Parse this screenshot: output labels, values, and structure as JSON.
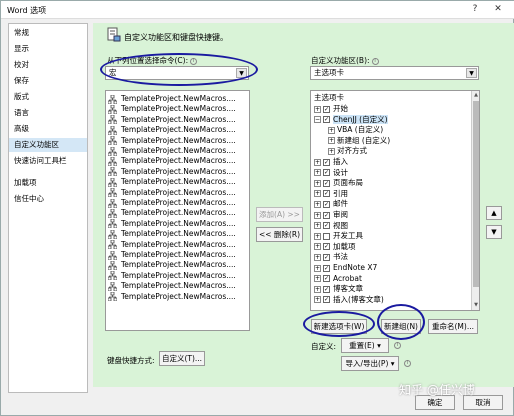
{
  "window": {
    "title": "Word 选项",
    "help_glyph": "?",
    "close_glyph": "✕"
  },
  "nav": {
    "items": [
      {
        "label": "常规"
      },
      {
        "label": "显示"
      },
      {
        "label": "校对"
      },
      {
        "label": "保存"
      },
      {
        "label": "版式"
      },
      {
        "label": "语言"
      },
      {
        "label": "高级"
      },
      {
        "label": "自定义功能区"
      },
      {
        "label": "快速访问工具栏"
      },
      {
        "label": "加载项"
      },
      {
        "label": "信任中心"
      }
    ],
    "selected_index": 7
  },
  "main": {
    "heading": "自定义功能区和键盘快捷键。",
    "left_label": "从下列位置选择命令(C):",
    "left_combo_value": "宏",
    "right_label": "自定义功能区(B):",
    "right_combo_value": "主选项卡",
    "commands": [
      "TemplateProject.NewMacros....",
      "TemplateProject.NewMacros....",
      "TemplateProject.NewMacros....",
      "TemplateProject.NewMacros....",
      "TemplateProject.NewMacros....",
      "TemplateProject.NewMacros....",
      "TemplateProject.NewMacros....",
      "TemplateProject.NewMacros....",
      "TemplateProject.NewMacros....",
      "TemplateProject.NewMacros....",
      "TemplateProject.NewMacros....",
      "TemplateProject.NewMacros....",
      "TemplateProject.NewMacros....",
      "TemplateProject.NewMacros....",
      "TemplateProject.NewMacros....",
      "TemplateProject.NewMacros....",
      "TemplateProject.NewMacros....",
      "TemplateProject.NewMacros....",
      "TemplateProject.NewMacros....",
      "TemplateProject.NewMacros...."
    ],
    "add_button": "添加(A) >>",
    "remove_button": "<< 删除(R)",
    "tree_header": "主选项卡",
    "tree": [
      {
        "label": "开始",
        "level": 0,
        "expander": "+",
        "checked": true
      },
      {
        "label": "ChenJJ (自定义)",
        "level": 0,
        "expander": "−",
        "checked": true,
        "selected": true
      },
      {
        "label": "VBA (自定义)",
        "level": 1,
        "expander": "+",
        "checked": null
      },
      {
        "label": "新建组 (自定义)",
        "level": 1,
        "expander": "+",
        "checked": null
      },
      {
        "label": "对齐方式",
        "level": 1,
        "expander": "+",
        "checked": null
      },
      {
        "label": "插入",
        "level": 0,
        "expander": "+",
        "checked": true
      },
      {
        "label": "设计",
        "level": 0,
        "expander": "+",
        "checked": true
      },
      {
        "label": "页面布局",
        "level": 0,
        "expander": "+",
        "checked": true
      },
      {
        "label": "引用",
        "level": 0,
        "expander": "+",
        "checked": true
      },
      {
        "label": "邮件",
        "level": 0,
        "expander": "+",
        "checked": true
      },
      {
        "label": "审阅",
        "level": 0,
        "expander": "+",
        "checked": true
      },
      {
        "label": "视图",
        "level": 0,
        "expander": "+",
        "checked": true
      },
      {
        "label": "开发工具",
        "level": 0,
        "expander": "+",
        "checked": false
      },
      {
        "label": "加载项",
        "level": 0,
        "expander": "+",
        "checked": true
      },
      {
        "label": "书法",
        "level": 0,
        "expander": "+",
        "checked": true
      },
      {
        "label": "EndNote X7",
        "level": 0,
        "expander": "+",
        "checked": true
      },
      {
        "label": "Acrobat",
        "level": 0,
        "expander": "+",
        "checked": true
      },
      {
        "label": "博客文章",
        "level": 0,
        "expander": "+",
        "checked": true
      },
      {
        "label": "插入(博客文章)",
        "level": 0,
        "expander": "+",
        "checked": true
      }
    ],
    "move_up_glyph": "▲",
    "move_down_glyph": "▼",
    "new_tab_button": "新建选项卡(W)",
    "new_group_button": "新建组(N)",
    "rename_button": "重命名(M)...",
    "customize_label": "自定义:",
    "reset_button": "重置(E) ▾",
    "import_export_button": "导入/导出(P) ▾",
    "keyboard_label": "键盘快捷方式:",
    "keyboard_button": "自定义(T)..."
  },
  "footer": {
    "ok_button": "确定",
    "cancel_button": "取消"
  },
  "watermark": "知乎 @任兴博",
  "colors": {
    "panel_green": "#d9f3d7",
    "annotation_blue": "#1a1aa0"
  }
}
